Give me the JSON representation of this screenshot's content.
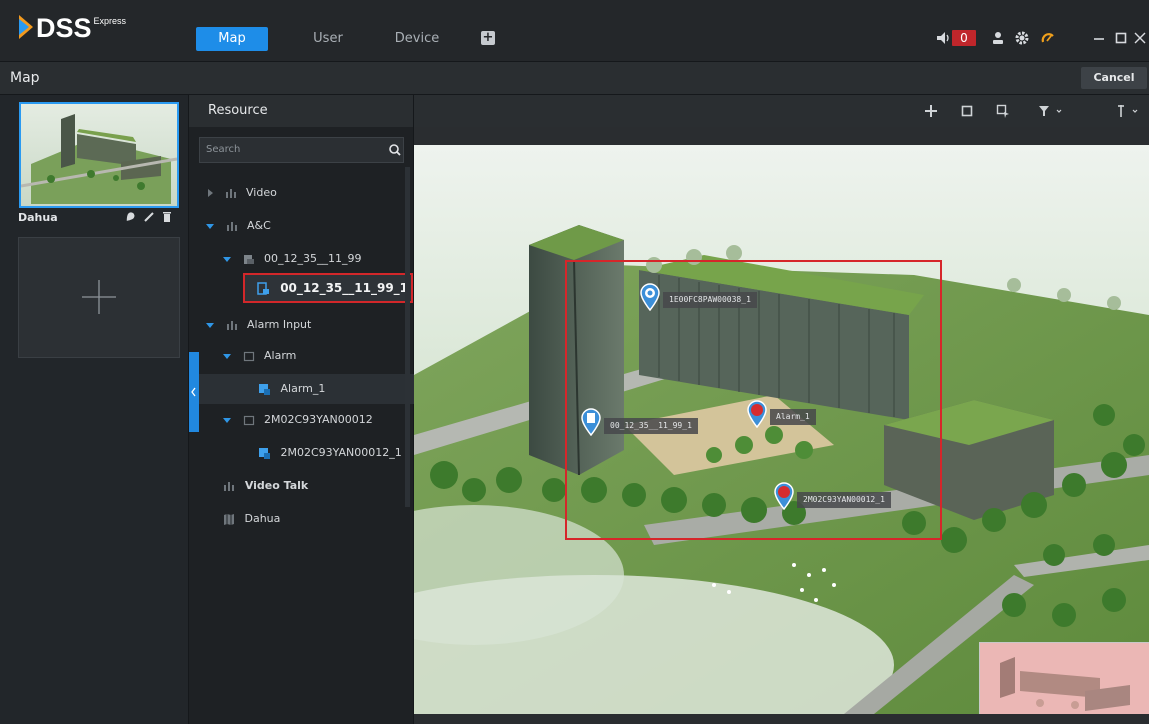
{
  "app": {
    "logo": "DSS",
    "logo_superscript": "Express"
  },
  "tabs": [
    {
      "label": "Map",
      "active": true
    },
    {
      "label": "User",
      "active": false
    },
    {
      "label": "Device",
      "active": false
    }
  ],
  "tray": {
    "alarm_count": "0",
    "accent_color": "#1e8de8",
    "alarm_color": "#c0262b"
  },
  "toolbar": {
    "title": "Map",
    "cancel_label": "Cancel"
  },
  "map_list": {
    "items": [
      {
        "label": "Dahua"
      }
    ]
  },
  "resource": {
    "title": "Resource",
    "search_placeholder": "Search",
    "tree": [
      {
        "label": "Video",
        "level": 0,
        "expanded": false
      },
      {
        "label": "A&C",
        "level": 0,
        "expanded": true
      },
      {
        "label": "00_12_35__11_99",
        "level": 1,
        "expanded": true
      },
      {
        "label": "00_12_35__11_99_1",
        "level": 2,
        "highlighted": true
      },
      {
        "label": "Alarm Input",
        "level": 0,
        "expanded": true
      },
      {
        "label": "Alarm",
        "level": 1,
        "expanded": true
      },
      {
        "label": "Alarm_1",
        "level": 2,
        "selected": true
      },
      {
        "label": "2M02C93YAN00012",
        "level": 1,
        "expanded": true
      },
      {
        "label": "2M02C93YAN00012_1",
        "level": 2
      },
      {
        "label": "Video Talk",
        "level": 0
      },
      {
        "label": "Dahua",
        "level": 0
      }
    ]
  },
  "map": {
    "devices": [
      {
        "label": "1E00FC8PAW00038_1",
        "icon": "camera-pin-icon"
      },
      {
        "label": "00_12_35__11_99_1",
        "icon": "door-pin-icon"
      },
      {
        "label": "Alarm_1",
        "icon": "alarm-pin-icon"
      },
      {
        "label": "2M02C93YAN00012_1",
        "icon": "alarm-pin-icon"
      }
    ]
  }
}
